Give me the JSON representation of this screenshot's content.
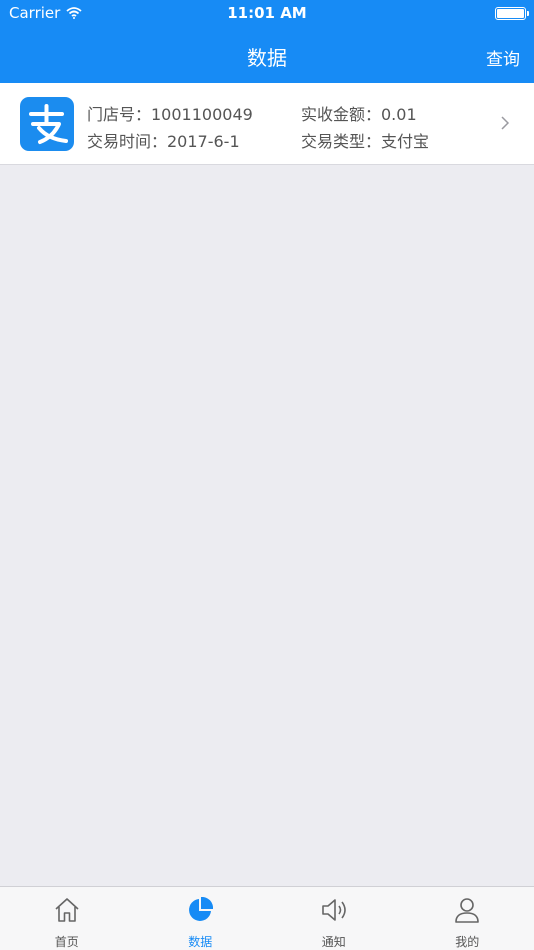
{
  "status_bar": {
    "carrier": "Carrier",
    "time": "11:01 AM"
  },
  "nav": {
    "title": "数据",
    "right_action": "查询"
  },
  "transaction": {
    "logo_icon": "alipay-icon",
    "store_no": "门店号：1001100049",
    "amount": "实收金额：0.01",
    "time": "交易时间：2017-6-1",
    "type": "交易类型：支付宝"
  },
  "tabs": [
    {
      "label": "首页",
      "icon": "home-icon",
      "active": false
    },
    {
      "label": "数据",
      "icon": "pie-chart-icon",
      "active": true
    },
    {
      "label": "通知",
      "icon": "speaker-icon",
      "active": false
    },
    {
      "label": "我的",
      "icon": "user-icon",
      "active": false
    }
  ],
  "colors": {
    "primary": "#178bf5",
    "background": "#ececf1",
    "tab_inactive": "#555555"
  }
}
